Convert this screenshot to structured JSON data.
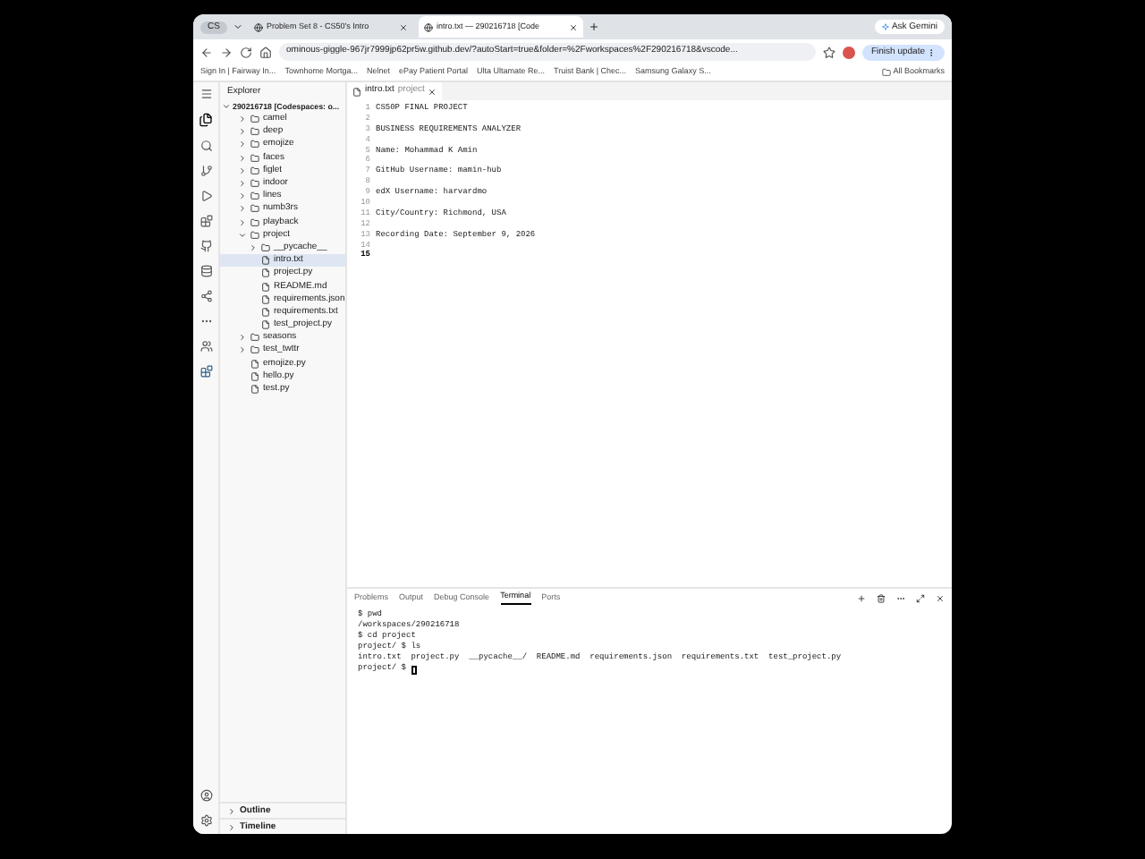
{
  "browser": {
    "tab_group": "CS",
    "tabs": [
      {
        "title": "Problem Set 8 - CS50's Intro",
        "selected": false
      },
      {
        "title": "intro.txt — 290216718 [Code",
        "selected": true
      }
    ],
    "url": "ominous-giggle-967jr7999jp62pr5w.github.dev/?autoStart=true&folder=%2Fworkspaces%2F290216718&vscode...",
    "ask_button": "Ask Gemini",
    "update_button": "Finish update",
    "bookmarks": [
      "Sign In | Fairway In...",
      "Townhome Mortga...",
      "Nelnet",
      "ePay Patient Portal",
      "Ulta Ultamate Re...",
      "Truist Bank | Chec...",
      "Samsung Galaxy S..."
    ],
    "all_bookmarks": "All Bookmarks"
  },
  "explorer": {
    "title": "Explorer",
    "root": {
      "name": "290216718 [Codespaces: o...",
      "expanded": true,
      "children": [
        {
          "name": "camel",
          "kind": "folder",
          "expanded": false,
          "selected": false
        },
        {
          "name": "deep",
          "kind": "folder",
          "expanded": false,
          "selected": false
        },
        {
          "name": "emojize",
          "kind": "folder",
          "expanded": false,
          "selected": false
        },
        {
          "name": "faces",
          "kind": "folder",
          "expanded": false,
          "selected": false
        },
        {
          "name": "figlet",
          "kind": "folder",
          "expanded": false,
          "selected": false
        },
        {
          "name": "indoor",
          "kind": "folder",
          "expanded": false,
          "selected": false
        },
        {
          "name": "lines",
          "kind": "folder",
          "expanded": false,
          "selected": false
        },
        {
          "name": "numb3rs",
          "kind": "folder",
          "expanded": false,
          "selected": false
        },
        {
          "name": "playback",
          "kind": "folder",
          "expanded": false,
          "selected": false
        },
        {
          "name": "project",
          "kind": "folder",
          "expanded": true,
          "selected": false,
          "children": [
            {
              "name": "__pycache__",
              "kind": "folder",
              "expanded": false,
              "selected": false
            },
            {
              "name": "intro.txt",
              "kind": "file",
              "selected": true
            },
            {
              "name": "project.py",
              "kind": "file",
              "selected": false
            },
            {
              "name": "README.md",
              "kind": "file",
              "selected": false
            },
            {
              "name": "requirements.json",
              "kind": "file",
              "selected": false
            },
            {
              "name": "requirements.txt",
              "kind": "file",
              "selected": false
            },
            {
              "name": "test_project.py",
              "kind": "file",
              "selected": false
            }
          ]
        },
        {
          "name": "seasons",
          "kind": "folder",
          "expanded": false,
          "selected": false
        },
        {
          "name": "test_twttr",
          "kind": "folder",
          "expanded": false,
          "selected": false
        },
        {
          "name": "emojize.py",
          "kind": "file",
          "selected": false
        },
        {
          "name": "hello.py",
          "kind": "file",
          "selected": false
        },
        {
          "name": "test.py",
          "kind": "file",
          "selected": false
        }
      ]
    },
    "sections": [
      "Outline",
      "Timeline"
    ]
  },
  "editor": {
    "tab": {
      "name": "intro.txt",
      "description": "project"
    },
    "lines": [
      {
        "number": "1",
        "text": "CS50P FINAL PROJECT"
      },
      {
        "number": "2"
      },
      {
        "number": "3",
        "text": "BUSINESS REQUIREMENTS ANALYZER"
      },
      {
        "number": "4"
      },
      {
        "number": "5",
        "text": "Name: Mohammad K Amin"
      },
      {
        "number": "6"
      },
      {
        "number": "7",
        "text": "GitHub Username: mamin-hub"
      },
      {
        "number": "8"
      },
      {
        "number": "9",
        "text": "edX Username: harvardmo"
      },
      {
        "number": "10"
      },
      {
        "number": "11",
        "text": "City/Country: Richmond, USA"
      },
      {
        "number": "12"
      },
      {
        "number": "13",
        "text": "Recording Date: September 9, 2026"
      },
      {
        "number": "14"
      },
      {
        "number": "15",
        "current": true
      }
    ]
  },
  "panel": {
    "tabs": [
      {
        "label": "Problems",
        "selected": false
      },
      {
        "label": "Output",
        "selected": false
      },
      {
        "label": "Debug Console",
        "selected": false
      },
      {
        "label": "Terminal",
        "selected": true
      },
      {
        "label": "Ports",
        "selected": false
      }
    ],
    "terminal": [
      "$ pwd",
      "/workspaces/290216718",
      "$ cd project",
      "project/ $ ls",
      "intro.txt  project.py  __pycache__/  README.md  requirements.json  requirements.txt  test_project.py",
      "project/ $ "
    ]
  }
}
